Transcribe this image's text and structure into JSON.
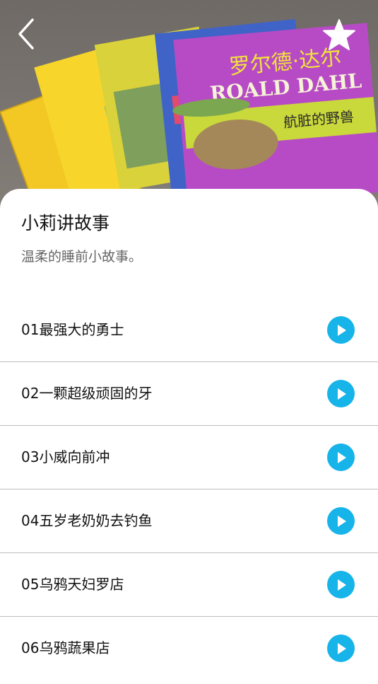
{
  "header": {
    "back_icon": "chevron-left-icon",
    "favorite_icon": "star-icon",
    "cover_texts": {
      "series_cn": "罗尔德·达尔",
      "series_en": "ROALD DAHL",
      "book_title": "航脏的野兽"
    }
  },
  "album": {
    "title": "小莉讲故事",
    "description": "温柔的睡前小故事。"
  },
  "episodes": [
    {
      "title": "01最强大的勇士"
    },
    {
      "title": "02一颗超级顽固的牙"
    },
    {
      "title": "03小威向前冲"
    },
    {
      "title": "04五岁老奶奶去钓鱼"
    },
    {
      "title": "05乌鸦天妇罗店"
    },
    {
      "title": "06乌鸦蔬果店"
    }
  ],
  "colors": {
    "accent": "#16b4e8",
    "divider": "#bdbdbd"
  }
}
